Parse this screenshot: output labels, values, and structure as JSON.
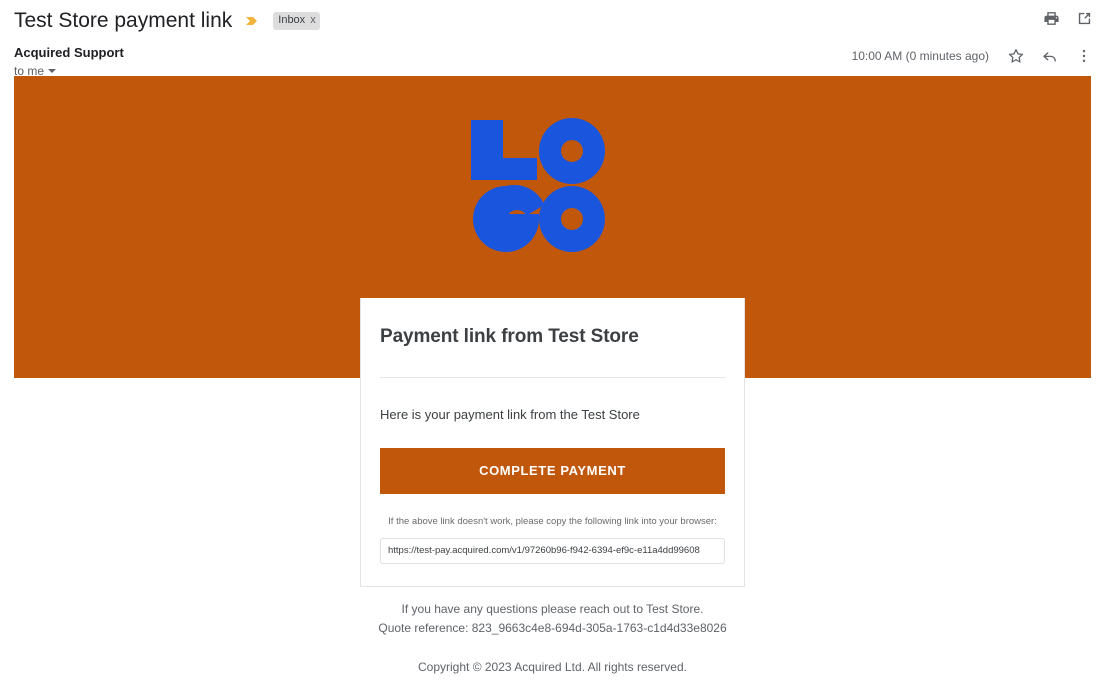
{
  "header": {
    "subject": "Test Store payment link",
    "important_marker_icon": "important-arrow-icon",
    "label": {
      "name": "Inbox",
      "remove": "x"
    },
    "print_icon": "print-icon",
    "open_in_new_icon": "open-in-new-window-icon"
  },
  "message_meta": {
    "sender": "Acquired Support",
    "recipient": "to me",
    "recipient_caret_icon": "chevron-down-icon",
    "timestamp": "10:00 AM (0 minutes ago)",
    "star_icon": "star-icon",
    "reply_icon": "reply-icon",
    "more_icon": "more-options-icon"
  },
  "email": {
    "banner": {
      "background_color": "#c1570b",
      "logo_text": "LOGO",
      "logo_color": "#1a56dd"
    },
    "card": {
      "title": "Payment link from Test Store",
      "body": "Here is your payment link from the Test Store",
      "cta_label": "COMPLETE PAYMENT",
      "cta_color": "#c1570b",
      "helper_text": "If the above link doesn't work, please copy the following link into your browser:",
      "payment_url": "https://test-pay.acquired.com/v1/97260b96-f942-6394-ef9c-e11a4dd99608"
    },
    "footer": {
      "questions": "If you have any questions please reach out to Test Store.",
      "quote_reference": "Quote reference: 823_9663c4e8-694d-305a-1763-c1d4d33e8026",
      "copyright": "Copyright © 2023 Acquired Ltd. All rights reserved."
    }
  }
}
